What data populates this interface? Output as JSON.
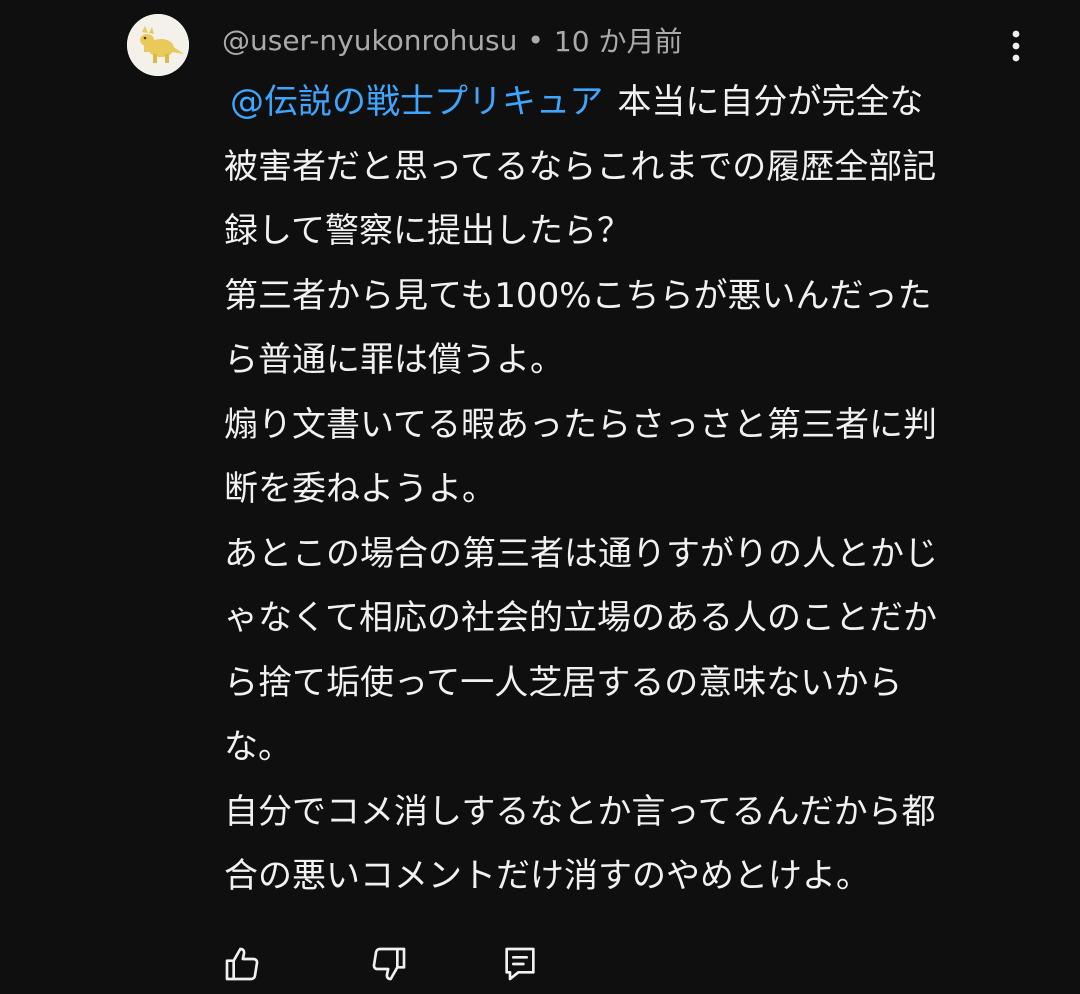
{
  "comment": {
    "author": "@user-nyukonrohusu",
    "separator": "•",
    "timestamp": "10 か月前",
    "mention": "@伝説の戦士プリキュア",
    "lines": [
      "本当に自分が完全な",
      "被害者だと思ってるならこれまでの履歴全部記",
      "録して警察に提出したら？",
      "第三者から見ても100%こちらが悪いんだった",
      "ら普通に罪は償うよ。",
      "煽り文書いてる暇あったらさっさと第三者に判",
      "断を委ねようよ。",
      "あとこの場合の第三者は通りすがりの人とかじ",
      "ゃなくて相応の社会的立場のある人のことだか",
      "ら捨て垢使って一人芝居するの意味ないから",
      "な。",
      "自分でコメ消しするなとか言ってるんだから都",
      "合の悪いコメントだけ消すのやめとけよ。"
    ]
  },
  "icons": {
    "avatar": "yellow-dinosaur-figure",
    "more": "more-vertical-icon",
    "like": "thumbs-up-icon",
    "dislike": "thumbs-down-icon",
    "reply": "reply-comment-icon"
  },
  "colors": {
    "background": "#0f0f0f",
    "text": "#f1f1f1",
    "meta": "#aaaaaa",
    "mention": "#3ea6ff"
  }
}
